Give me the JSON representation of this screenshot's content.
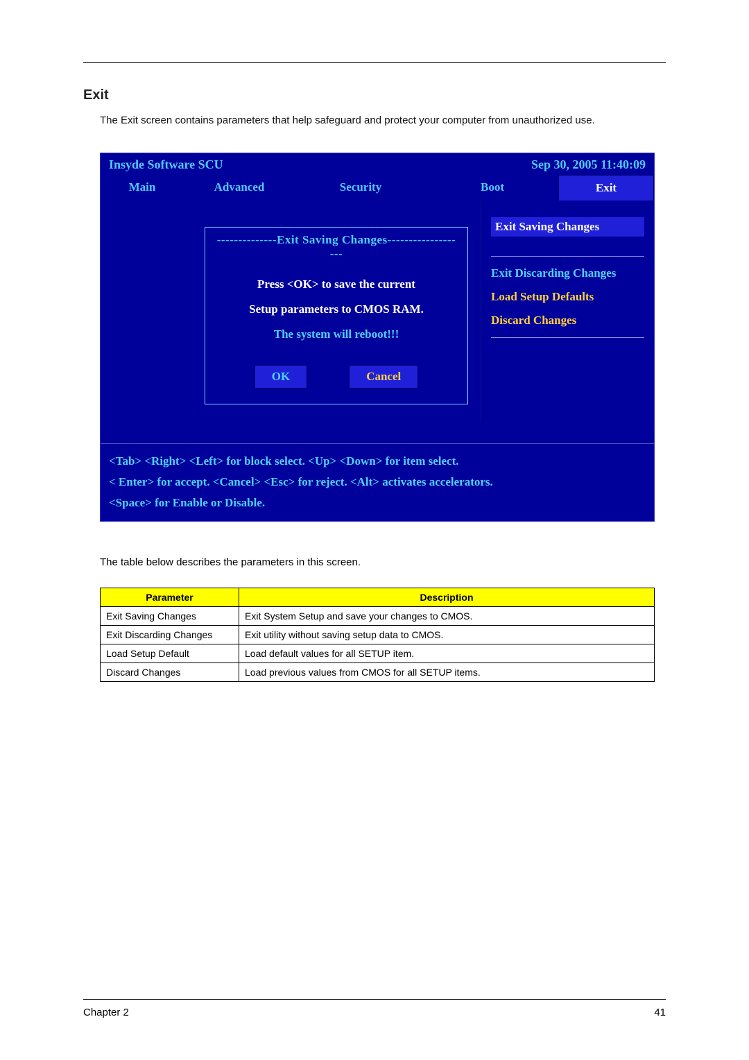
{
  "heading": "Exit",
  "intro": "The Exit screen contains parameters that help safeguard and protect your computer from unauthorized use.",
  "bios": {
    "title": "Insyde Software SCU",
    "datetime": "Sep 30, 2005 11:40:09",
    "tabs": [
      "Main",
      "Advanced",
      "Security",
      "Boot",
      "Exit"
    ],
    "right_menu": {
      "active": "Exit Saving Changes",
      "items": [
        "Exit Discarding Changes",
        "Load Setup Defaults",
        "Discard Changes"
      ]
    },
    "dialog": {
      "title": "--------------Exit Saving Changes-------------------",
      "line1": "Press   <OK>   to   save   the current",
      "line2": "Setup parameters to CMOS RAM.",
      "line3": "The system will reboot!!!",
      "ok": "OK",
      "cancel": "Cancel"
    },
    "help": {
      "l1": "<Tab> <Right> <Left> for block select.   <Up> <Down> for item select.",
      "l2": "< Enter> for accept. <Cancel> <Esc> for reject. <Alt> activates accelerators.",
      "l3": "<Space> for Enable or Disable."
    }
  },
  "table_intro": "The table below describes the parameters in this screen.",
  "table": {
    "headers": [
      "Parameter",
      "Description"
    ],
    "rows": [
      [
        "Exit Saving Changes",
        "Exit System Setup and save your changes to CMOS."
      ],
      [
        "Exit Discarding Changes",
        "Exit utility without saving setup data to CMOS."
      ],
      [
        "Load Setup Default",
        "Load default values for all SETUP item."
      ],
      [
        "Discard Changes",
        "Load previous values from CMOS for all SETUP items."
      ]
    ]
  },
  "footer": {
    "left": "Chapter 2",
    "right": "41"
  }
}
